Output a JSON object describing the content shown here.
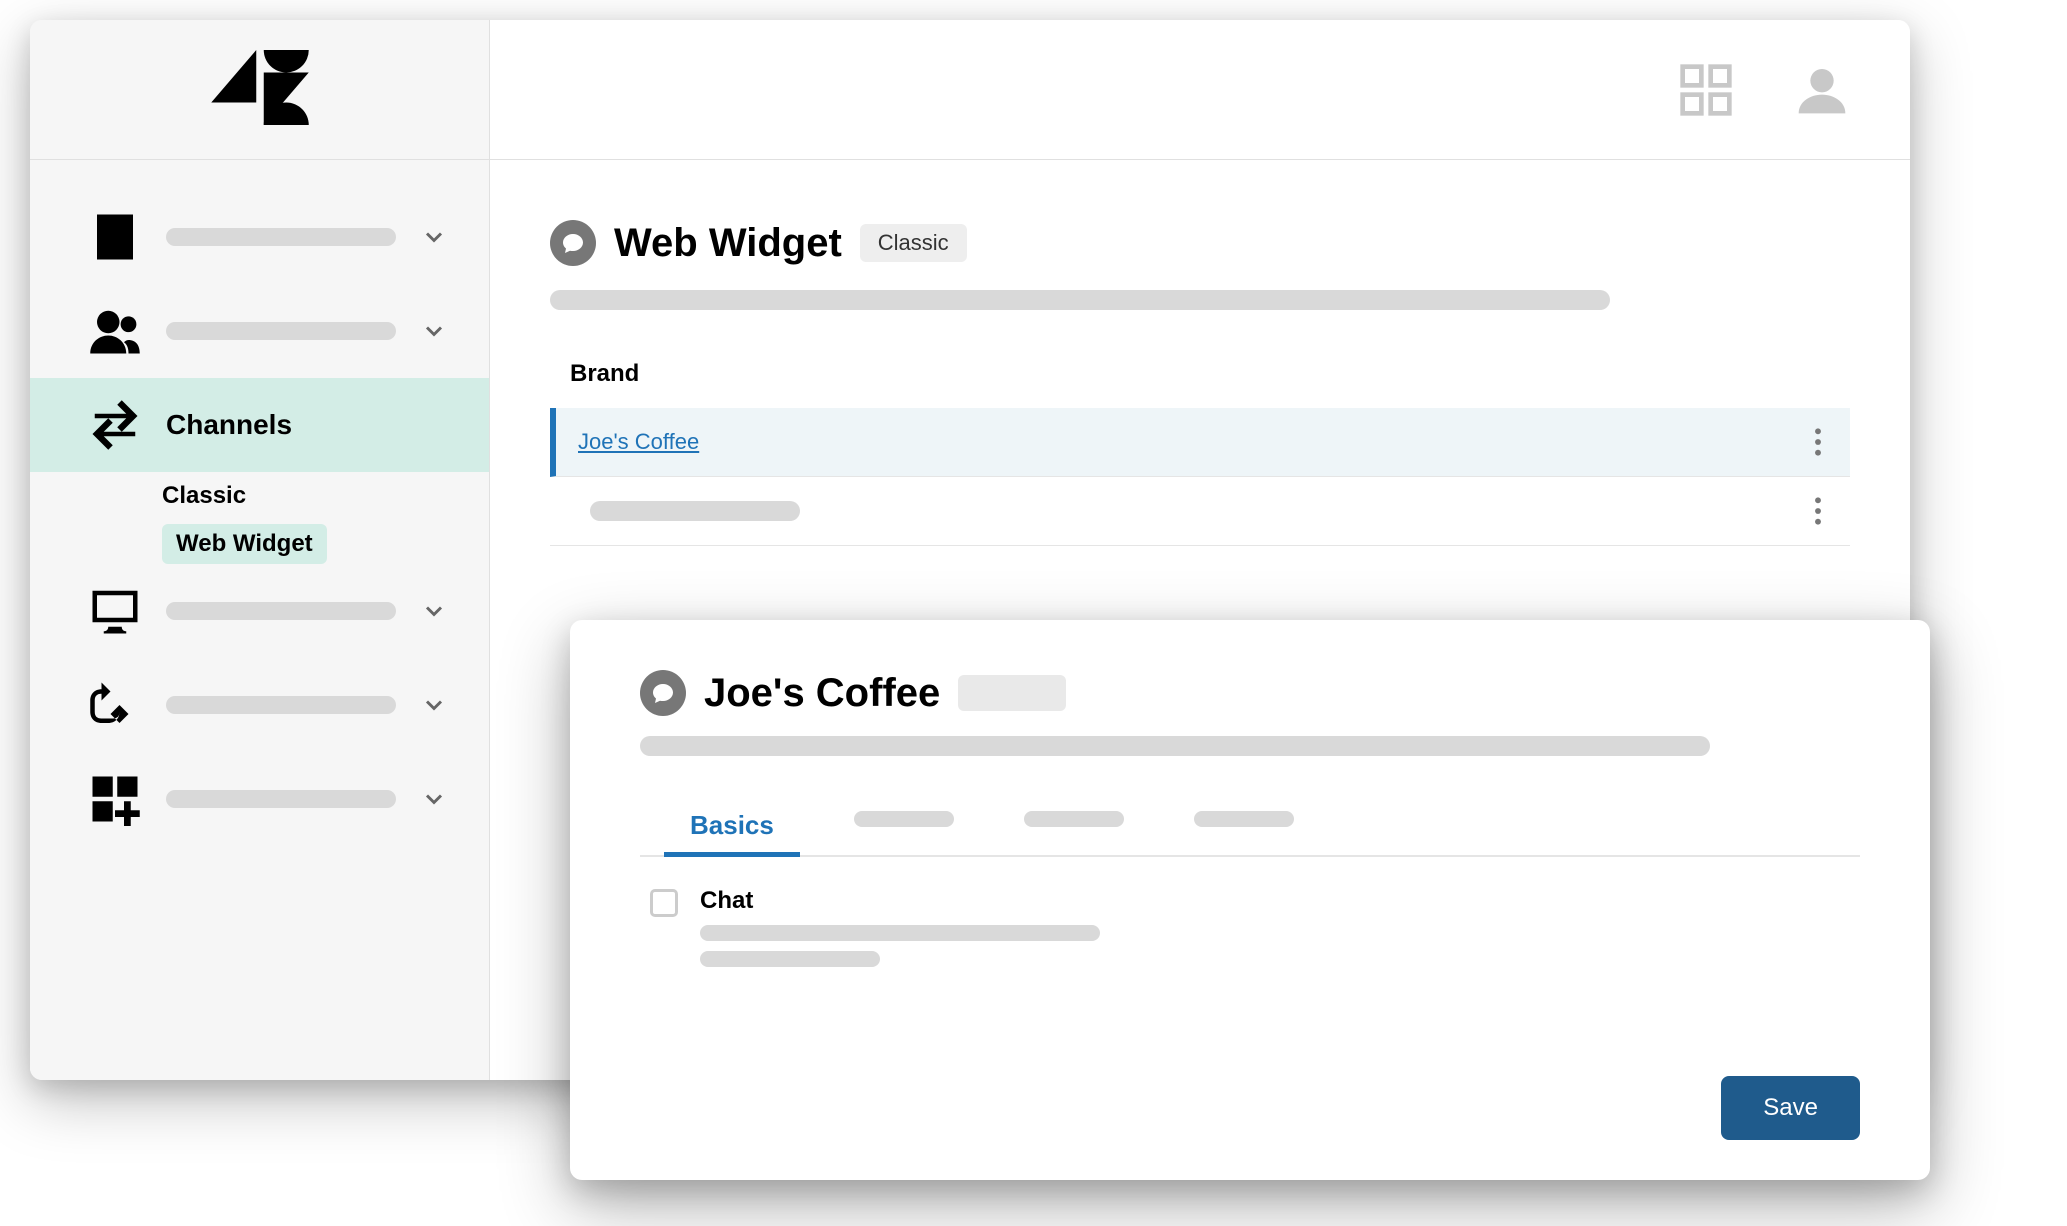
{
  "sidebar": {
    "active_label": "Channels",
    "sub_items": [
      "Classic",
      "Web Widget"
    ],
    "active_sub_index": 1
  },
  "topbar": {},
  "page": {
    "title": "Web Widget",
    "badge": "Classic",
    "section_label": "Brand",
    "brands": [
      {
        "name": "Joe's Coffee",
        "selected": true
      },
      {
        "name": "",
        "selected": false
      }
    ]
  },
  "panel": {
    "title": "Joe's Coffee",
    "tabs": [
      "Basics"
    ],
    "active_tab": 0,
    "option_label": "Chat",
    "save_label": "Save"
  }
}
